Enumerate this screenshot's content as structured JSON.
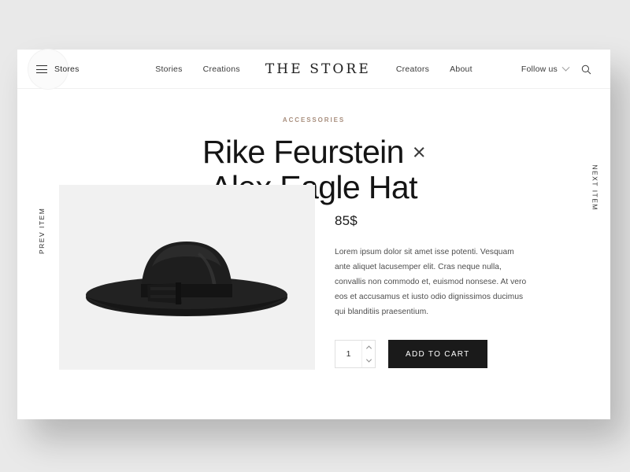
{
  "nav": {
    "menu_label": "Stores",
    "menu_icon": "hamburger-icon",
    "brand": "THE STORE",
    "links": [
      {
        "label": "Stories"
      },
      {
        "label": "Creations"
      },
      {
        "label": "Creators"
      },
      {
        "label": "About"
      }
    ],
    "follow_label": "Follow us",
    "follow_icon": "chevron-down-icon",
    "search_icon": "search-icon"
  },
  "rails": {
    "prev": "PREV ITEM",
    "next": "NEXT ITEM"
  },
  "product": {
    "category": "ACCESSORIES",
    "title_line1": "Rike Feurstein",
    "separator": "×",
    "title_line2": "Alex Eagle Hat",
    "price": "85$",
    "description": "Lorem ipsum dolor sit amet isse potenti. Vesquam ante aliquet lacusemper elit. Cras neque nulla, convallis non commodo et, euismod nonsese. At vero eos et accusamus et iusto odio dignissimos ducimus qui blanditiis praesentium.",
    "quantity": "1",
    "add_to_cart_label": "ADD TO CART",
    "image_alt": "black-wide-brim-fedora-hat"
  },
  "colors": {
    "page_background": "#e9e9e9",
    "card_background": "#ffffff",
    "accent_category": "#a98f7e",
    "button_background": "#1a1a1a",
    "image_background": "#f1f1f1",
    "text_primary": "#141414"
  }
}
